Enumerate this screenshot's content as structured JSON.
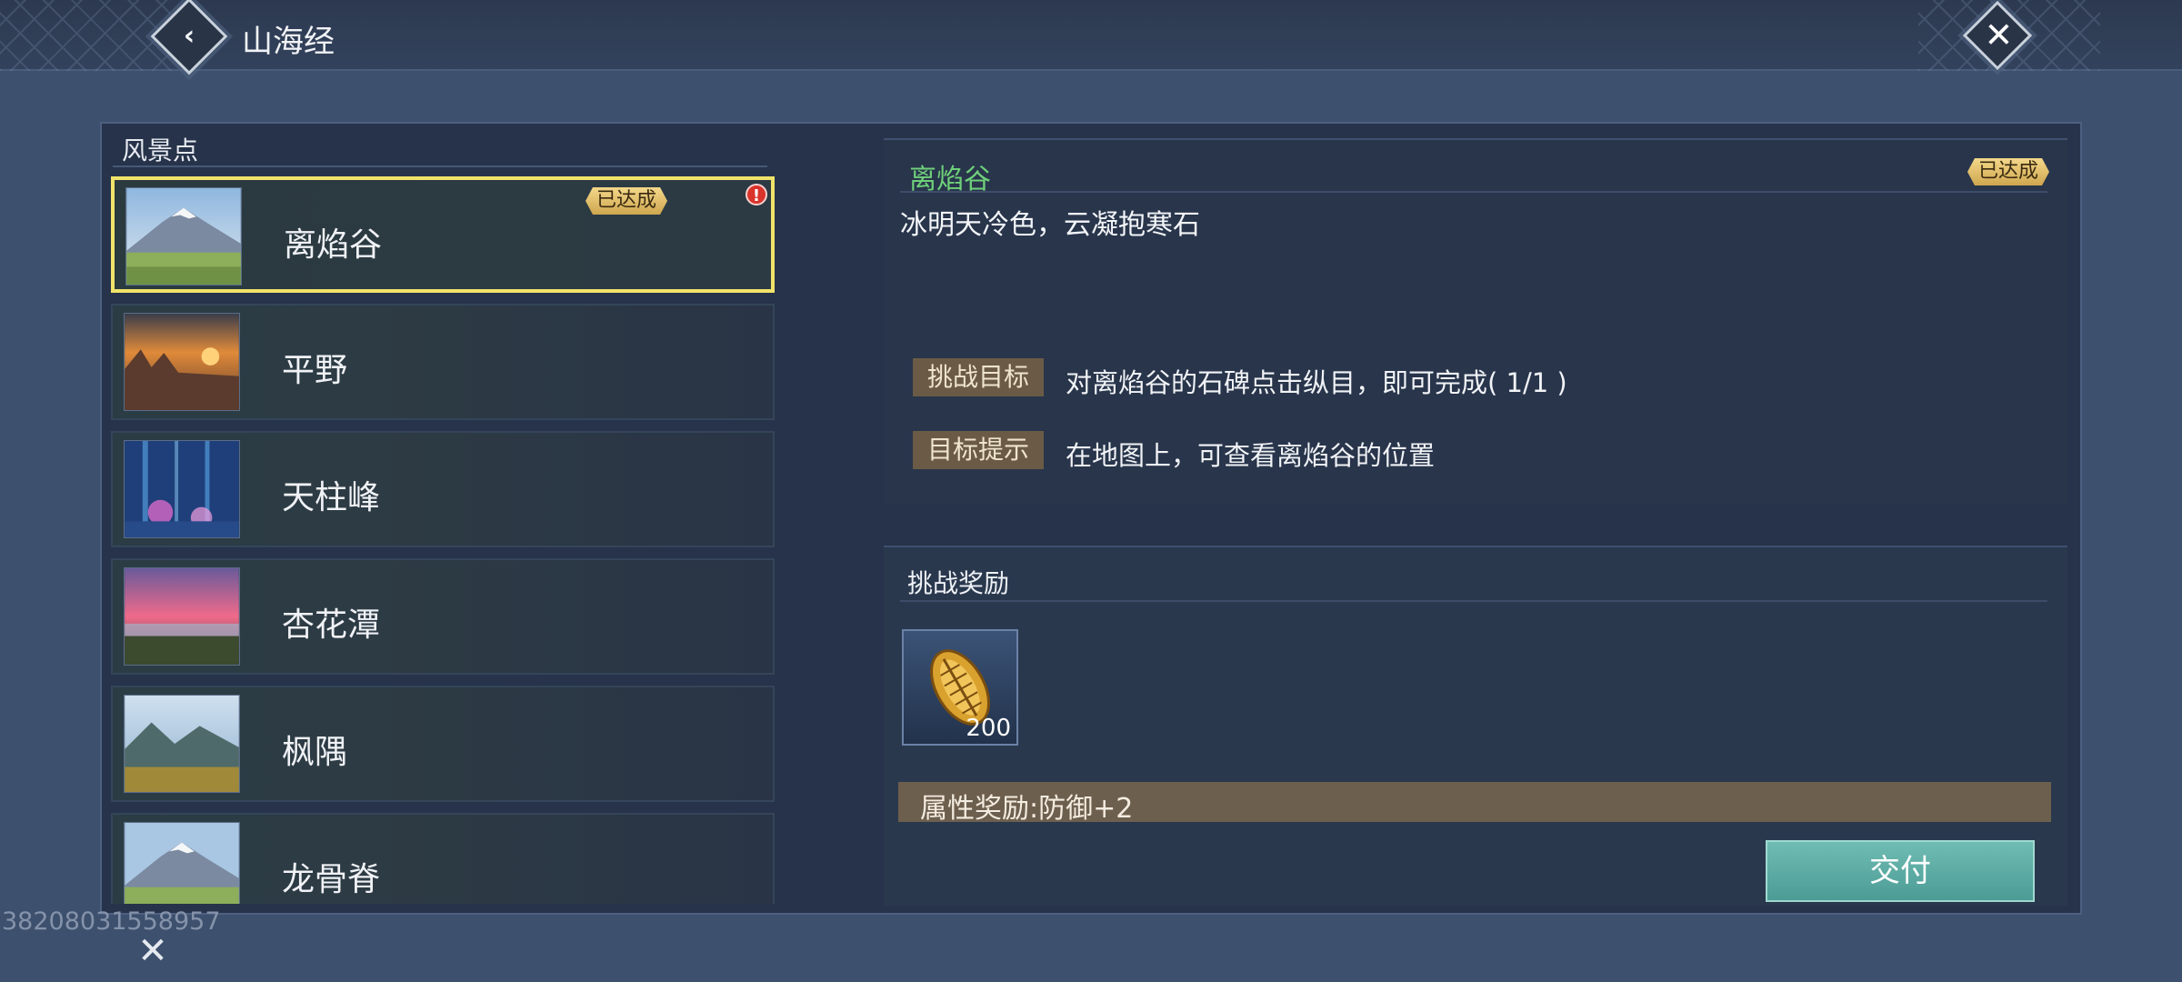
{
  "header": {
    "title": "山海经",
    "back_icon": "chevron-left-icon",
    "close_icon": "close-icon"
  },
  "left_panel": {
    "section_label": "风景点",
    "items": [
      {
        "name": "离焰谷",
        "badge": "已达成",
        "alert": "!",
        "selected": true,
        "thumb": "snowy-mountain-meadow"
      },
      {
        "name": "平野",
        "thumb": "sunset-rocky-plain"
      },
      {
        "name": "天柱峰",
        "thumb": "blue-magic-forest"
      },
      {
        "name": "杏花潭",
        "thumb": "pink-sky-lake"
      },
      {
        "name": "枫隅",
        "thumb": "mountain-valley"
      },
      {
        "name": "龙骨脊",
        "thumb": "snowy-mountain"
      }
    ]
  },
  "detail": {
    "title": "离焰谷",
    "badge": "已达成",
    "description": "冰明天冷色，云凝抱寒石",
    "challenge_tag": "挑战目标",
    "challenge_text": "对离焰谷的石碑点击纵目，即可完成( 1/1 )",
    "hint_tag": "目标提示",
    "hint_text": "在地图上，可查看离焰谷的位置"
  },
  "reward": {
    "title": "挑战奖励",
    "item_icon": "golden-leaf-shell-icon",
    "item_count": "200",
    "attr_text": "属性奖励:防御+2",
    "submit_label": "交付"
  },
  "footer": {
    "uid": "38208031558957",
    "close_icon": "close-icon"
  },
  "colors": {
    "selected_border": "#f1e36a",
    "title_green": "#6fd07a",
    "submit_bg": "#5aaba4",
    "badge_gold": "#e0bf6a",
    "alert_red": "#d9332b"
  }
}
